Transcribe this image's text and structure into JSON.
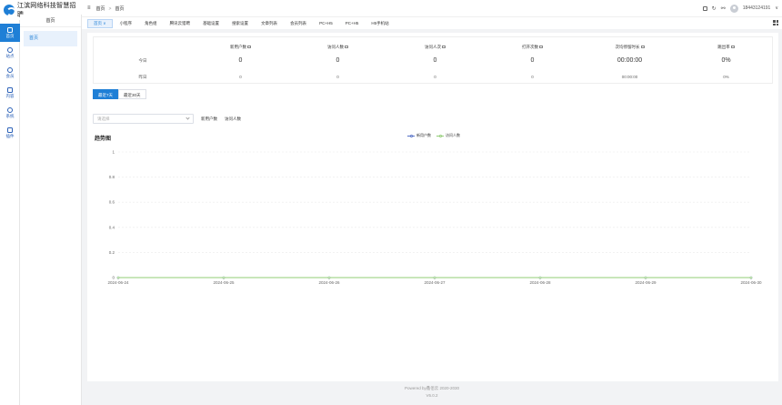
{
  "app": {
    "title": "江滨网络科技智慧招聘"
  },
  "rail": {
    "items": [
      {
        "label": "首页",
        "icon": "monitor-icon",
        "active": true
      },
      {
        "label": "站点",
        "icon": "globe-icon",
        "active": false
      },
      {
        "label": "会员",
        "icon": "user-icon",
        "active": false
      },
      {
        "label": "内容",
        "icon": "folder-icon",
        "active": false
      },
      {
        "label": "系统",
        "icon": "gear-icon",
        "active": false
      },
      {
        "label": "插件",
        "icon": "box-icon",
        "active": false
      }
    ]
  },
  "submenu": {
    "title": "首页",
    "items": [
      {
        "label": "首页"
      }
    ]
  },
  "header": {
    "breadcrumb": [
      "首页",
      "首页"
    ],
    "username": "18443124191"
  },
  "tabs": [
    {
      "label": "首页",
      "active": true
    },
    {
      "label": "小程序"
    },
    {
      "label": "角色组"
    },
    {
      "label": "腾讯云猎聘"
    },
    {
      "label": "基础设置"
    },
    {
      "label": "搜索设置"
    },
    {
      "label": "文章列表"
    },
    {
      "label": "会员列表"
    },
    {
      "label": "PC+H5"
    },
    {
      "label": "PC+H5"
    },
    {
      "label": "H5手机站"
    }
  ],
  "stats": {
    "headers": [
      "新用户数",
      "访问人数",
      "访问人次",
      "打开次数",
      "次均停留时长",
      "跳出率"
    ],
    "today": {
      "label": "今日",
      "values": [
        "0",
        "0",
        "0",
        "0",
        "00:00:00",
        "0%"
      ]
    },
    "yesterday": {
      "label": "昨日",
      "values": [
        "0",
        "0",
        "0",
        "0",
        "00:00:00",
        "0%"
      ]
    }
  },
  "range": {
    "options": [
      "最近7天",
      "最近30天"
    ],
    "active": 0
  },
  "filter": {
    "select_placeholder": "请选择",
    "metrics": [
      "新用户数",
      "访问人数"
    ]
  },
  "chart_title": "趋势图",
  "chart_data": {
    "type": "line",
    "title": "趋势图",
    "x": [
      "2024-06-24",
      "2024-06-25",
      "2024-06-26",
      "2024-06-27",
      "2024-06-28",
      "2024-06-29",
      "2024-06-30"
    ],
    "series": [
      {
        "name": "新用户数",
        "values": [
          0,
          0,
          0,
          0,
          0,
          0,
          0
        ],
        "color": "#5470c6"
      },
      {
        "name": "访问人数",
        "values": [
          0,
          0,
          0,
          0,
          0,
          0,
          0
        ],
        "color": "#91cc75"
      }
    ],
    "y_ticks": [
      "0",
      "0.2",
      "0.4",
      "0.6",
      "0.8",
      "1"
    ],
    "ylim": [
      0,
      1
    ],
    "grid": true,
    "legend": "top-center"
  },
  "footer": {
    "line1": "Powered by鑫佰云 2020-2030",
    "line2": "V6.0.2"
  },
  "colors": {
    "primary": "#1f7fd6",
    "series1": "#5470c6",
    "series2": "#91cc75"
  }
}
